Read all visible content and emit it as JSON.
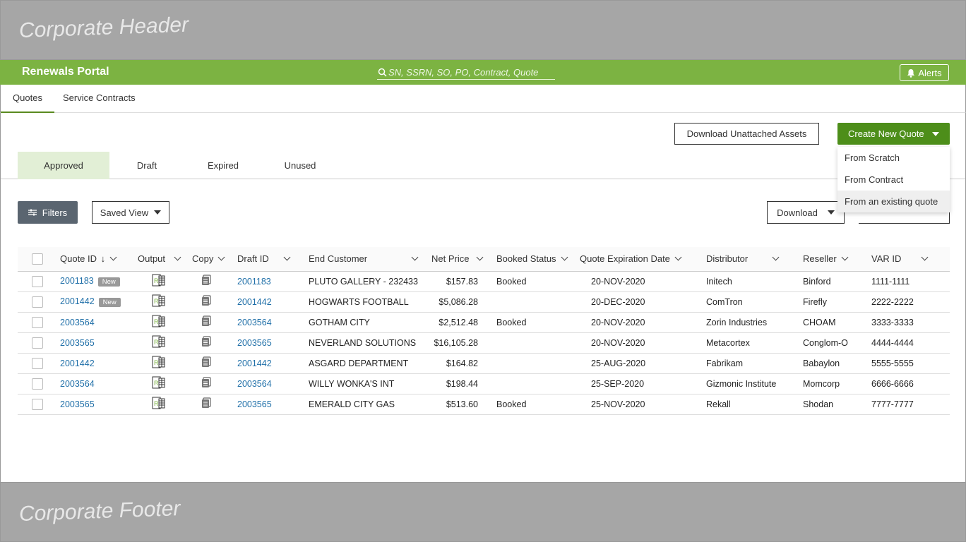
{
  "corporate": {
    "header": "Corporate Header",
    "footer": "Corporate Footer"
  },
  "topbar": {
    "portal_title": "Renewals Portal",
    "search_placeholder": "SN, SSRN, SO, PO, Contract, Quote",
    "alerts_label": "Alerts"
  },
  "main_tabs": [
    {
      "label": "Quotes",
      "active": true
    },
    {
      "label": "Service Contracts",
      "active": false
    }
  ],
  "actions": {
    "download_unattached": "Download Unattached Assets",
    "create_new_quote": "Create New Quote",
    "create_menu": [
      "From Scratch",
      "From Contract",
      "From an existing quote"
    ],
    "download": "Download"
  },
  "status_tabs": [
    {
      "label": "Approved",
      "active": true
    },
    {
      "label": "Draft",
      "active": false
    },
    {
      "label": "Expired",
      "active": false
    },
    {
      "label": "Unused",
      "active": false
    }
  ],
  "toolbar": {
    "filters": "Filters",
    "saved_view": "Saved View"
  },
  "table": {
    "columns": [
      "Quote ID",
      "Output",
      "Copy",
      "Draft ID",
      "End Customer",
      "Net Price",
      "Booked Status",
      "Quote Expiration Date",
      "Distributor",
      "Reseller",
      "VAR ID"
    ],
    "new_badge": "New",
    "rows": [
      {
        "quote_id": "2001183",
        "is_new": true,
        "draft_id": "2001183",
        "end_customer": "PLUTO GALLERY - 232433",
        "net_price": "$157.83",
        "booked": "Booked",
        "expiration": "20-NOV-2020",
        "distributor": "Initech",
        "reseller": "Binford",
        "var_id": "1111-1111"
      },
      {
        "quote_id": "2001442",
        "is_new": true,
        "draft_id": "2001442",
        "end_customer": "HOGWARTS FOOTBALL",
        "net_price": "$5,086.28",
        "booked": "",
        "expiration": "20-DEC-2020",
        "distributor": "ComTron",
        "reseller": "Firefly",
        "var_id": "2222-2222"
      },
      {
        "quote_id": "2003564",
        "is_new": false,
        "draft_id": "2003564",
        "end_customer": "GOTHAM CITY",
        "net_price": "$2,512.48",
        "booked": "Booked",
        "expiration": "20-NOV-2020",
        "distributor": "Zorin Industries",
        "reseller": "CHOAM",
        "var_id": "3333-3333"
      },
      {
        "quote_id": "2003565",
        "is_new": false,
        "draft_id": "2003565",
        "end_customer": "NEVERLAND SOLUTIONS",
        "net_price": "$16,105.28",
        "booked": "",
        "expiration": "20-NOV-2020",
        "distributor": "Metacortex",
        "reseller": "Conglom-O",
        "var_id": "4444-4444"
      },
      {
        "quote_id": "2001442",
        "is_new": false,
        "draft_id": "2001442",
        "end_customer": "ASGARD DEPARTMENT",
        "net_price": "$164.82",
        "booked": "",
        "expiration": "25-AUG-2020",
        "distributor": "Fabrikam",
        "reseller": "Babaylon",
        "var_id": "5555-5555"
      },
      {
        "quote_id": "2003564",
        "is_new": false,
        "draft_id": "2003564",
        "end_customer": "WILLY WONKA'S INT",
        "net_price": "$198.44",
        "booked": "",
        "expiration": "25-SEP-2020",
        "distributor": "Gizmonic Institute",
        "reseller": "Momcorp",
        "var_id": "6666-6666"
      },
      {
        "quote_id": "2003565",
        "is_new": false,
        "draft_id": "2003565",
        "end_customer": "EMERALD CITY GAS",
        "net_price": "$513.60",
        "booked": "Booked",
        "expiration": "25-NOV-2020",
        "distributor": "Rekall",
        "reseller": "Shodan",
        "var_id": "7777-7777"
      }
    ]
  },
  "colors": {
    "brand_green": "#7cb342",
    "button_green": "#4d8e1a",
    "link": "#1f6fa8",
    "active_tab_bg": "#e2efd6"
  }
}
